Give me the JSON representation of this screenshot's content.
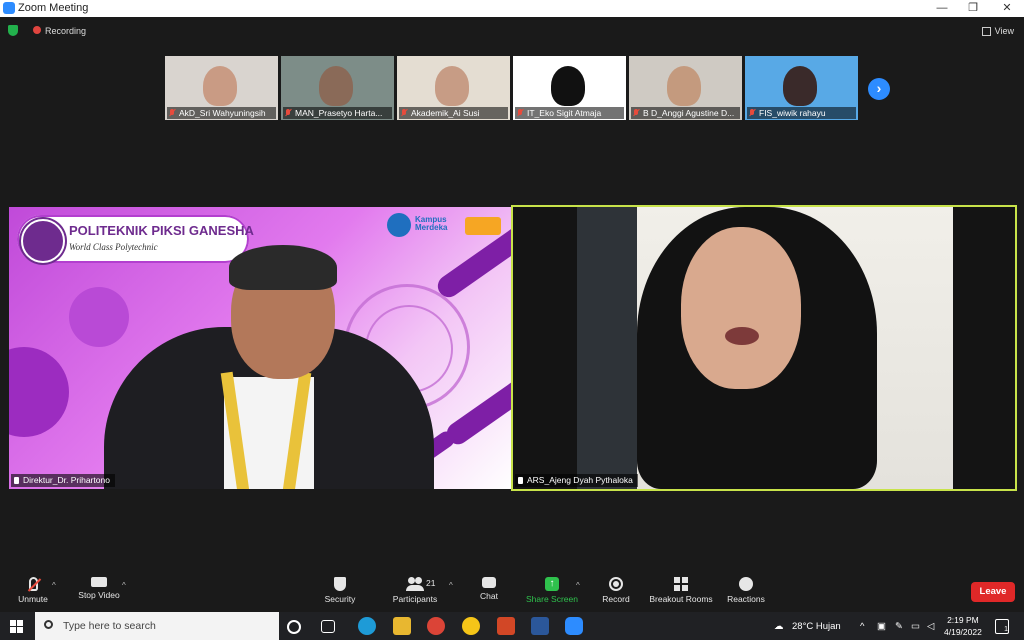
{
  "window": {
    "title": "Zoom Meeting",
    "minimize": "—",
    "restore": "❐",
    "close": "✕"
  },
  "topbar": {
    "recording": "Recording",
    "view": "View"
  },
  "thumbnails": [
    {
      "name": "AkD_Sri Wahyuningsih",
      "bg": "#d9d4cf",
      "face": "#c99b84"
    },
    {
      "name": "MAN_Prasetyo Harta...",
      "bg": "#7d8d88",
      "face": "#8a6a58"
    },
    {
      "name": "Akademik_Ai Susi",
      "bg": "#e4ddd2",
      "face": "#c79c85"
    },
    {
      "name": "IT_Eko Sigit Atmaja",
      "bg": "#ffffff",
      "face": "#111111"
    },
    {
      "name": "B D_Anggi Agustine D...",
      "bg": "#cfcac3",
      "face": "#c49a7e"
    },
    {
      "name": "FIS_wiwik rahayu",
      "bg": "#58a9e6",
      "face": "#3a2a2a"
    }
  ],
  "tiles": {
    "left": {
      "name": "Direktur_Dr. Prihartono",
      "brand_title": "POLITEKNIK PIKSI GANESHA",
      "brand_sub": "World Class Polytechnic",
      "kampus_merdeka": "Kampus Merdeka"
    },
    "right": {
      "name": "ARS_Ajeng Dyah Pythaloka"
    }
  },
  "toolbar": {
    "unmute": "Unmute",
    "stop_video": "Stop Video",
    "security": "Security",
    "participants": "Participants",
    "participants_count": "21",
    "chat": "Chat",
    "share_screen": "Share Screen",
    "share_glyph": "↑",
    "record": "Record",
    "breakout_rooms": "Breakout Rooms",
    "reactions": "Reactions",
    "leave": "Leave",
    "caret": "^"
  },
  "taskbar": {
    "search_placeholder": "Type here to search",
    "weather": "28°C  Hujan",
    "time": "2:19 PM",
    "date": "4/19/2022",
    "notif_count": "1"
  },
  "colors": {
    "accent_blue": "#2d8cff",
    "active_speaker_border": "#c8e34a",
    "leave_red": "#e02828",
    "share_green": "#2fc24d"
  }
}
